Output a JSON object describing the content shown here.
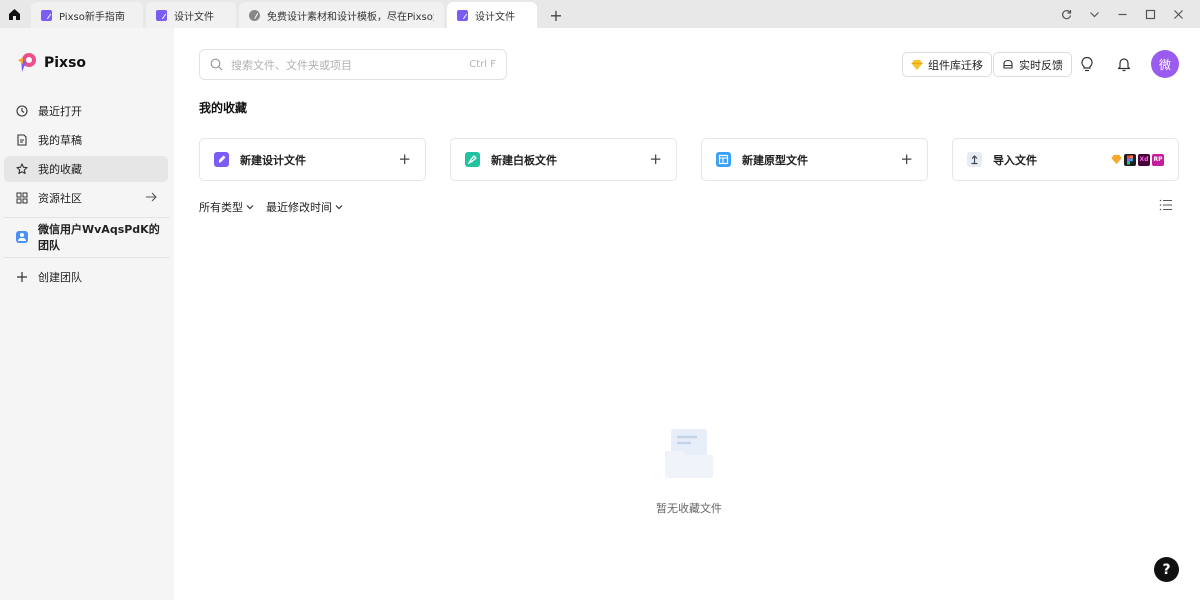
{
  "tabs": [
    {
      "label": "Pixso新手指南",
      "icon": "pen-icon"
    },
    {
      "label": "设计文件",
      "icon": "pen-icon"
    },
    {
      "label": "免费设计素材和设计模板，尽在Pixso资源社区",
      "icon": "globe-icon"
    },
    {
      "label": "设计文件",
      "icon": "pen-icon"
    }
  ],
  "tab_add_label": "+",
  "brand": {
    "name": "Pixso",
    "accent": "#7b5cf5"
  },
  "sidebar": {
    "items": [
      {
        "label": "最近打开",
        "icon": "clock-icon"
      },
      {
        "label": "我的草稿",
        "icon": "draft-icon"
      },
      {
        "label": "我的收藏",
        "icon": "star-icon",
        "active": true
      },
      {
        "label": "资源社区",
        "icon": "grid-icon"
      }
    ],
    "team": {
      "label": "微信用户WvAqsPdK的团队",
      "icon": "team-icon"
    },
    "create_team": {
      "label": "创建团队",
      "icon": "plus-icon"
    }
  },
  "search": {
    "placeholder": "搜索文件、文件夹或项目",
    "shortcut": "Ctrl F"
  },
  "header": {
    "migrate_label": "组件库迁移",
    "feedback_label": "实时反馈",
    "avatar_text": "微"
  },
  "main": {
    "title": "我的收藏",
    "cards": [
      {
        "label": "新建设计文件",
        "icon": "design-file-icon",
        "color": "#7b5cf5"
      },
      {
        "label": "新建白板文件",
        "icon": "whiteboard-icon",
        "color": "#22c3a0"
      },
      {
        "label": "新建原型文件",
        "icon": "prototype-icon",
        "color": "#3aa0f5"
      },
      {
        "label": "导入文件",
        "icon": "upload-icon",
        "color": "#e8ecf2"
      }
    ],
    "import_logos": [
      {
        "text": "",
        "color": "#f7a72b",
        "icon": "sketch-icon"
      },
      {
        "text": "",
        "color": "#1e1e1e",
        "icon": "figma-icon"
      },
      {
        "text": "Xd",
        "color": "#470137",
        "icon": "xd-icon"
      },
      {
        "text": "RP",
        "color": "#c41c9c",
        "icon": "axure-icon"
      }
    ],
    "filters": {
      "type_label": "所有类型",
      "sort_label": "最近修改时间"
    },
    "empty_text": "暂无收藏文件"
  },
  "help_label": "?"
}
